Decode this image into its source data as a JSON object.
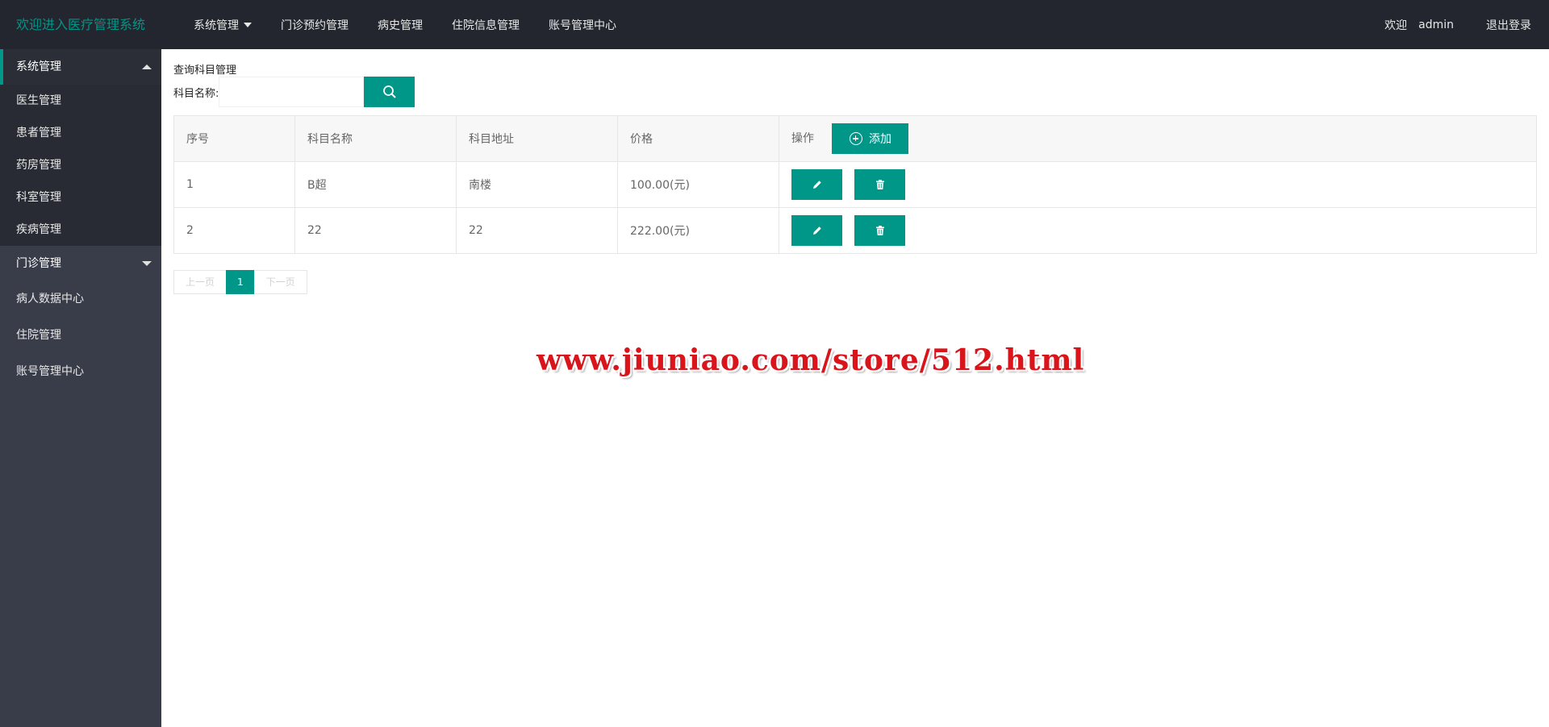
{
  "header": {
    "logo": "欢迎进入医疗管理系统",
    "nav": [
      {
        "label": "系统管理",
        "has_caret": true
      },
      {
        "label": "门诊预约管理"
      },
      {
        "label": "病史管理"
      },
      {
        "label": "住院信息管理"
      },
      {
        "label": "账号管理中心"
      }
    ],
    "welcome": "欢迎",
    "username": "admin",
    "logout": "退出登录"
  },
  "sidebar": {
    "group1": {
      "label": "系统管理",
      "items": [
        "医生管理",
        "患者管理",
        "药房管理",
        "科室管理",
        "疾病管理"
      ]
    },
    "group2": {
      "label": "门诊管理"
    },
    "items": [
      "病人数据中心",
      "住院管理",
      "账号管理中心"
    ]
  },
  "main": {
    "section_title": "查询科目管理",
    "search": {
      "label": "科目名称:",
      "value": "",
      "placeholder": ""
    },
    "table": {
      "headers": [
        "序号",
        "科目名称",
        "科目地址",
        "价格",
        "操作"
      ],
      "add_label": "添加",
      "rows": [
        [
          "1",
          "B超",
          "南楼",
          "100.00(元)"
        ],
        [
          "2",
          "22",
          "22",
          "222.00(元)"
        ]
      ]
    },
    "pager": {
      "prev": "上一页",
      "current": "1",
      "next": "下一页"
    }
  },
  "watermark": "www.jiuniao.com/store/512.html",
  "colors": {
    "accent": "#009688",
    "header_bg": "#23262e",
    "sidebar_bg": "#393d49"
  },
  "icons": {
    "search": "search-icon",
    "edit": "pencil-icon",
    "delete": "trash-icon",
    "add": "plus-circle-icon"
  }
}
